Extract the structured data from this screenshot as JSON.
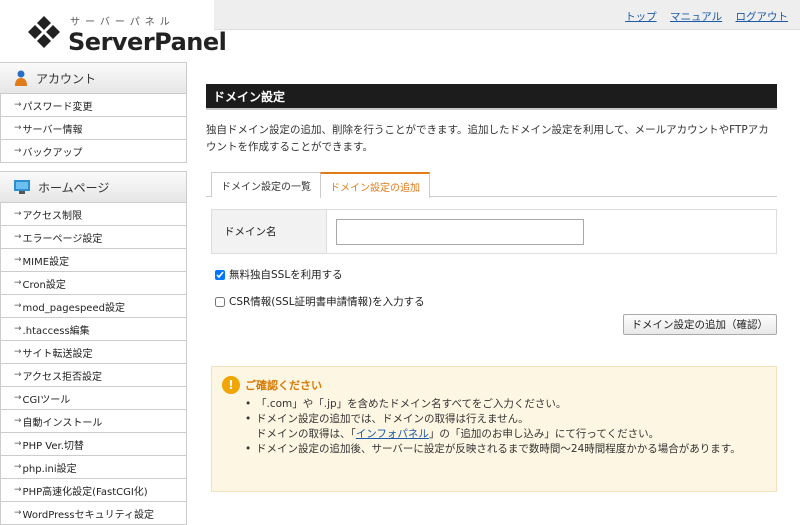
{
  "logo": {
    "sub": "サーバーパネル",
    "main": "ServerPanel"
  },
  "toplinks": [
    "トップ",
    "マニュアル",
    "ログアウト"
  ],
  "sidebar": {
    "account": {
      "title": "アカウント",
      "items": [
        "パスワード変更",
        "サーバー情報",
        "バックアップ"
      ]
    },
    "homepage": {
      "title": "ホームページ",
      "items": [
        "アクセス制限",
        "エラーページ設定",
        "MIME設定",
        "Cron設定",
        "mod_pagespeed設定",
        ".htaccess編集",
        "サイト転送設定",
        "アクセス拒否設定",
        "CGIツール",
        "自動インストール",
        "PHP Ver.切替",
        "php.ini設定",
        "PHP高速化設定(FastCGI化)",
        "WordPressセキュリティ設定"
      ]
    }
  },
  "main": {
    "title": "ドメイン設定",
    "description": "独自ドメイン設定の追加、削除を行うことができます。追加したドメイン設定を利用して、メールアカウントやFTPアカウントを作成することができます。",
    "tabs": {
      "list": "ドメイン設定の一覧",
      "add": "ドメイン設定の追加"
    },
    "form": {
      "label": "ドメイン名",
      "value": ""
    },
    "ssl_label": "無料独自SSLを利用する",
    "csr_label": "CSR情報(SSL証明書申請情報)を入力する",
    "confirm_button": "ドメイン設定の追加（確認）",
    "notice": {
      "icon": "!",
      "title": "ご確認ください",
      "items": {
        "i1": "「.com」や「.jp」を含めたドメイン名すべてをご入力ください。",
        "i2a": "ドメイン設定の追加では、ドメインの取得は行えません。",
        "i2b_pre": "ドメインの取得は、「",
        "i2b_link": "インフォパネル",
        "i2b_post": "」の「追加のお申し込み」にて行ってください。",
        "i3": "ドメイン設定の追加後、サーバーに設定が反映されるまで数時間〜24時間程度かかる場合があります。"
      }
    }
  },
  "colors": {
    "accent": "#e07b1a",
    "link": "#1a5aa6",
    "title_bg": "#1c1c1c"
  }
}
